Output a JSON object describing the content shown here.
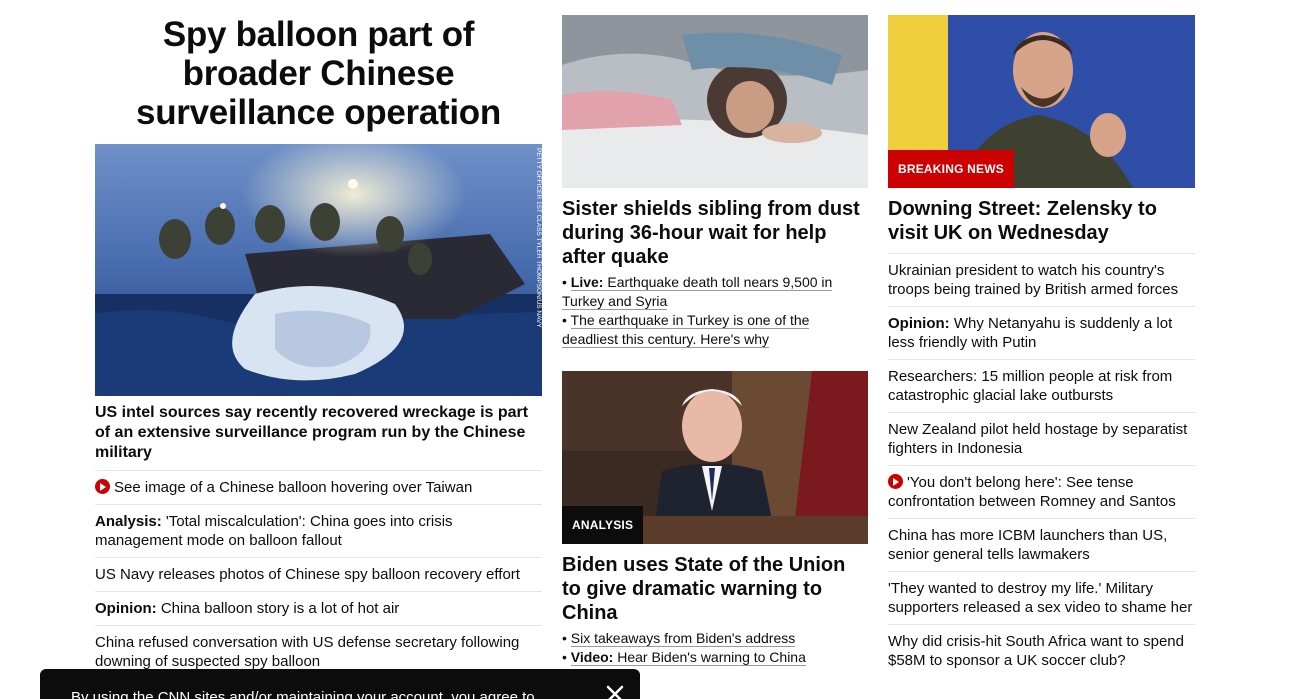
{
  "lead": {
    "headline": "Spy balloon part of broader Chinese surveillance operation",
    "photo_credit": "PETTY OFFICER 1ST CLASS TYLER THOMPSON/US NAVY",
    "sub_headline": "US intel sources say recently recovered wreckage is part of an extensive surveillance program run by the Chinese military",
    "links": [
      {
        "prefix": "",
        "text": "See image of a Chinese balloon hovering over Taiwan",
        "video": true
      },
      {
        "prefix": "Analysis:",
        "text": " 'Total miscalculation': China goes into crisis management mode on balloon fallout",
        "video": false
      },
      {
        "prefix": "",
        "text": "US Navy releases photos of Chinese spy balloon recovery effort",
        "video": false
      },
      {
        "prefix": "Opinion:",
        "text": " China balloon story is a lot of hot air",
        "video": false
      },
      {
        "prefix": "",
        "text": "China refused conversation with US defense secretary following downing of suspected spy balloon",
        "video": false
      }
    ]
  },
  "quake": {
    "headline": "Sister shields sibling from dust during 36-hour wait for help after quake",
    "bullets": [
      {
        "prefix": "Live:",
        "text": "Earthquake death toll nears 9,500 in Turkey and Syria"
      },
      {
        "prefix": "",
        "text": "The earthquake in Turkey is one of the deadliest this century. Here's why"
      }
    ]
  },
  "biden": {
    "badge": "ANALYSIS",
    "headline": "Biden uses State of the Union to give dramatic warning to China",
    "bullets": [
      {
        "prefix": "",
        "text": "Six takeaways from Biden's address"
      },
      {
        "prefix": "Video:",
        "text": "Hear Biden's warning to China"
      }
    ]
  },
  "zelensky": {
    "badge": "BREAKING NEWS",
    "headline": "Downing Street: Zelensky to visit UK on Wednesday",
    "links": [
      {
        "prefix": "",
        "text": "Ukrainian president to watch his country's troops being trained by British armed forces",
        "video": false
      },
      {
        "prefix": "Opinion:",
        "text": " Why Netanyahu is suddenly a lot less friendly with Putin",
        "video": false
      },
      {
        "prefix": "",
        "text": "Researchers: 15 million people at risk from catastrophic glacial lake outbursts",
        "video": false
      },
      {
        "prefix": "",
        "text": "New Zealand pilot held hostage by separatist fighters in Indonesia",
        "video": false
      },
      {
        "prefix": "",
        "text": "'You don't belong here': See tense confrontation between Romney and Santos",
        "video": true
      },
      {
        "prefix": "",
        "text": "China has more ICBM launchers than US, senior general tells lawmakers",
        "video": false
      },
      {
        "prefix": "",
        "text": "'They wanted to destroy my life.' Military supporters released a sex video to shame her",
        "video": false
      },
      {
        "prefix": "",
        "text": "Why did crisis-hit South Africa want to spend $58M to sponsor a UK soccer club?",
        "video": false
      }
    ]
  },
  "cookie_banner": {
    "text": "By using the CNN sites and/or maintaining your account, you agree to"
  },
  "colors": {
    "accent": "#cc0000",
    "text": "#0c0c0c",
    "divider": "#e6e6e6"
  },
  "icons": [
    "play-icon",
    "close-icon"
  ]
}
